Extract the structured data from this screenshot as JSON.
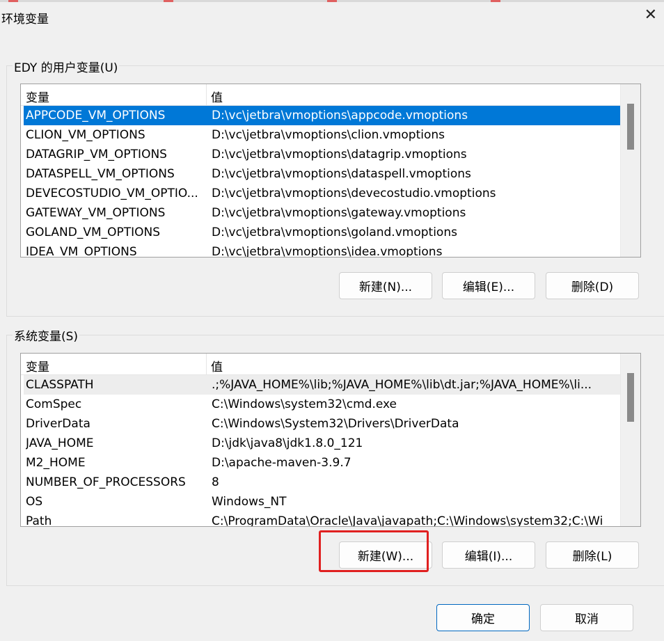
{
  "window": {
    "title": "环境变量"
  },
  "user_vars": {
    "label": "EDY 的用户变量(U)",
    "columns": [
      "变量",
      "值"
    ],
    "rows": [
      {
        "name": "APPCODE_VM_OPTIONS",
        "value": "D:\\vc\\jetbra\\vmoptions\\appcode.vmoptions"
      },
      {
        "name": "CLION_VM_OPTIONS",
        "value": "D:\\vc\\jetbra\\vmoptions\\clion.vmoptions"
      },
      {
        "name": "DATAGRIP_VM_OPTIONS",
        "value": "D:\\vc\\jetbra\\vmoptions\\datagrip.vmoptions"
      },
      {
        "name": "DATASPELL_VM_OPTIONS",
        "value": "D:\\vc\\jetbra\\vmoptions\\dataspell.vmoptions"
      },
      {
        "name": "DEVECOSTUDIO_VM_OPTIO...",
        "value": "D:\\vc\\jetbra\\vmoptions\\devecostudio.vmoptions"
      },
      {
        "name": "GATEWAY_VM_OPTIONS",
        "value": "D:\\vc\\jetbra\\vmoptions\\gateway.vmoptions"
      },
      {
        "name": "GOLAND_VM_OPTIONS",
        "value": "D:\\vc\\jetbra\\vmoptions\\goland.vmoptions"
      },
      {
        "name": "IDEA_VM_OPTIONS",
        "value": "D:\\vc\\jetbra\\vmoptions\\idea.vmoptions"
      }
    ],
    "buttons": {
      "new": "新建(N)...",
      "edit": "编辑(E)...",
      "delete": "删除(D)"
    }
  },
  "system_vars": {
    "label": "系统变量(S)",
    "columns": [
      "变量",
      "值"
    ],
    "rows": [
      {
        "name": "CLASSPATH",
        "value": ".;%JAVA_HOME%\\lib;%JAVA_HOME%\\lib\\dt.jar;%JAVA_HOME%\\li..."
      },
      {
        "name": "ComSpec",
        "value": "C:\\Windows\\system32\\cmd.exe"
      },
      {
        "name": "DriverData",
        "value": "C:\\Windows\\System32\\Drivers\\DriverData"
      },
      {
        "name": "JAVA_HOME",
        "value": "D:\\jdk\\java8\\jdk1.8.0_121"
      },
      {
        "name": "M2_HOME",
        "value": "D:\\apache-maven-3.9.7"
      },
      {
        "name": "NUMBER_OF_PROCESSORS",
        "value": "8"
      },
      {
        "name": "OS",
        "value": "Windows_NT"
      },
      {
        "name": "Path",
        "value": "C:\\ProgramData\\Oracle\\Java\\javapath;C:\\Windows\\system32;C:\\Wi"
      }
    ],
    "buttons": {
      "new": "新建(W)...",
      "edit": "编辑(I)...",
      "delete": "删除(L)"
    }
  },
  "footer": {
    "ok": "确定",
    "cancel": "取消"
  },
  "colors": {
    "selection": "#0078d7",
    "annotation": "#e02020",
    "primary_border": "#0067c0"
  },
  "icons": {
    "close": "close-icon"
  }
}
